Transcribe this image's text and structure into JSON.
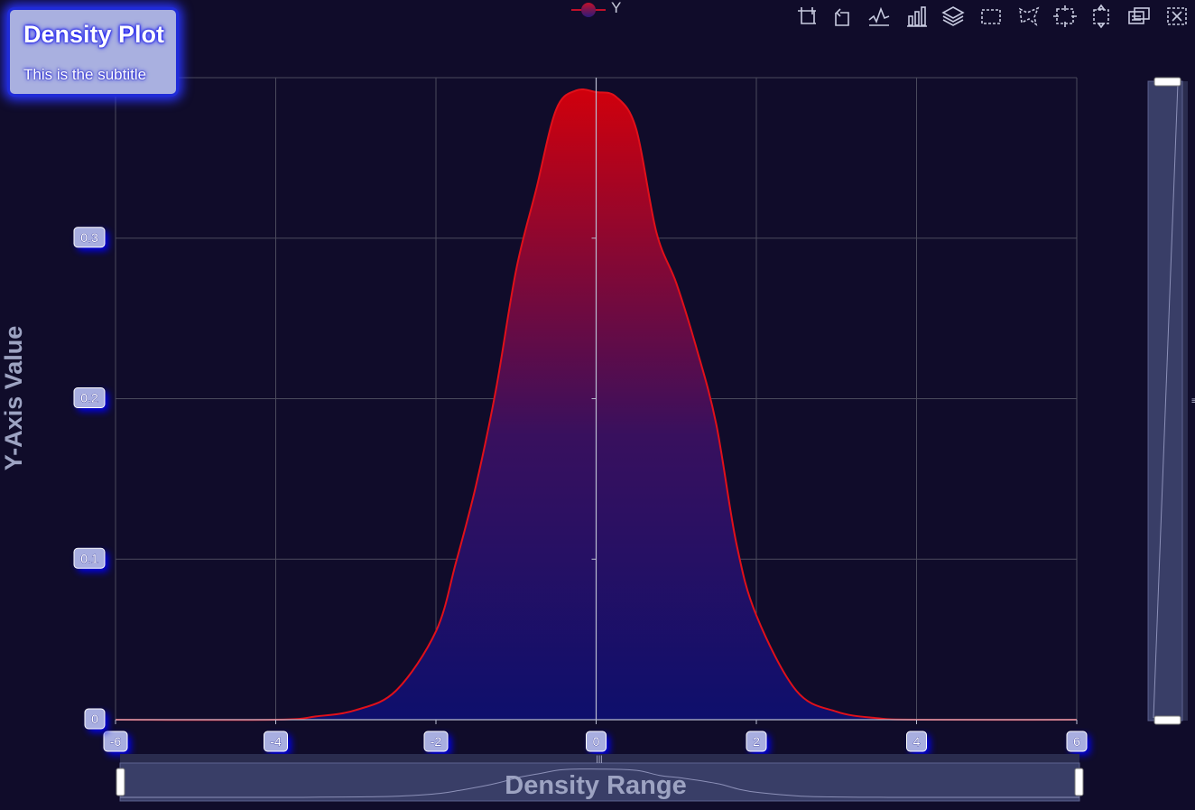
{
  "title": "Density Plot",
  "subtitle": "This is the subtitle",
  "legend": {
    "label": "Y"
  },
  "colors": {
    "background": "#100c2a",
    "area_top": "#d0000c",
    "area_bottom": "#0e0f6c",
    "line": "#e0101a",
    "badge_glow": "#0000ff"
  },
  "toolbox": {
    "icons": [
      "zoom-icon",
      "zoom-reset-icon",
      "line-chart-icon",
      "bar-chart-icon",
      "stack-icon",
      "rect-select-icon",
      "lasso-select-icon",
      "keep-select-icon",
      "clear-select-icon",
      "data-view-icon",
      "restore-icon"
    ]
  },
  "chart_data": {
    "type": "area",
    "xlabel": "Density Range",
    "ylabel": "Y-Axis Value",
    "xlim": [
      -6,
      6
    ],
    "ylim": [
      0,
      0.4
    ],
    "x_ticks": [
      "-6",
      "-4",
      "-2",
      "0",
      "2",
      "4",
      "6"
    ],
    "y_ticks": [
      "0",
      "0.1",
      "0.2",
      "0.3"
    ],
    "grid": true,
    "legend_position": "top-center",
    "series": [
      {
        "name": "Y",
        "x": [
          -6.0,
          -4.0,
          -3.5,
          -3.0,
          -2.5,
          -2.0,
          -1.75,
          -1.5,
          -1.25,
          -1.0,
          -0.75,
          -0.5,
          -0.25,
          0.0,
          0.25,
          0.5,
          0.75,
          1.0,
          1.25,
          1.5,
          1.75,
          2.0,
          2.5,
          3.0,
          3.5,
          4.0,
          6.0
        ],
        "y": [
          0.0,
          0.0,
          0.002,
          0.006,
          0.018,
          0.055,
          0.098,
          0.146,
          0.206,
          0.28,
          0.33,
          0.38,
          0.392,
          0.391,
          0.388,
          0.368,
          0.304,
          0.272,
          0.232,
          0.184,
          0.11,
          0.065,
          0.018,
          0.005,
          0.001,
          0.0,
          0.0
        ]
      }
    ]
  },
  "datazoom": {
    "x_range": [
      0,
      100
    ],
    "y_range": [
      0,
      100
    ]
  }
}
